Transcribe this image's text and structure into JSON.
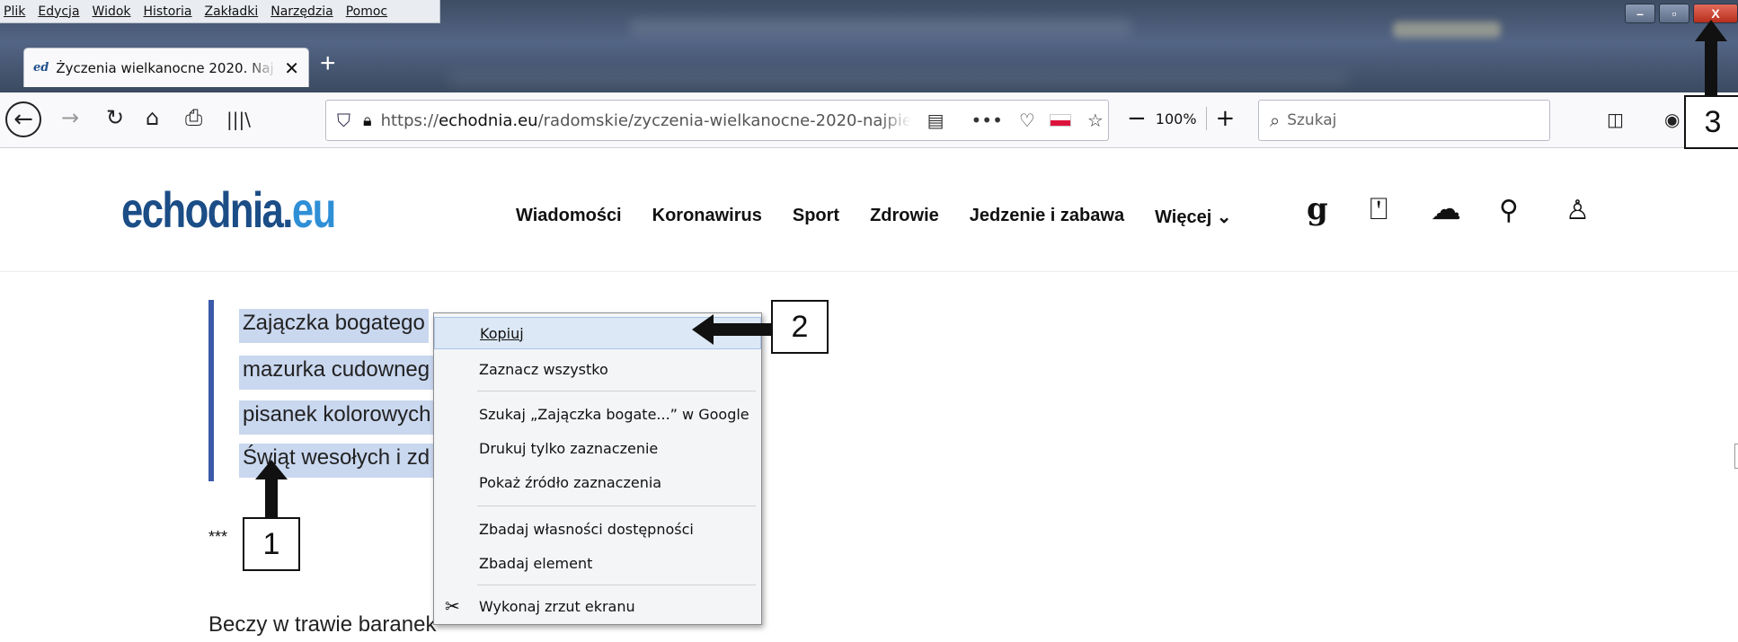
{
  "menubar": {
    "items": [
      {
        "label": "Plik"
      },
      {
        "label": "Edycja"
      },
      {
        "label": "Widok"
      },
      {
        "label": "Historia"
      },
      {
        "label": "Zakładki"
      },
      {
        "label": "Narzędzia"
      },
      {
        "label": "Pomoc"
      }
    ]
  },
  "window": {
    "minimize": "–",
    "restore": "▫",
    "close": "X"
  },
  "tab": {
    "favicon": "ed",
    "title": "Życzenia wielkanocne 2020. Naj",
    "close": "✕",
    "new_tab": "+"
  },
  "toolbar": {
    "url_prefix": "https://",
    "url_domain": "echodnia.eu",
    "url_path": "/radomskie/zyczenia-wielkanocne-2020-najpie",
    "zoom_out": "−",
    "zoom_level": "100%",
    "zoom_in": "+",
    "search_placeholder": "Szukaj"
  },
  "site": {
    "logo_main": "echodnia.",
    "logo_tld": "eu",
    "nav": [
      {
        "label": "Wiadomości"
      },
      {
        "label": "Koronawirus"
      },
      {
        "label": "Sport"
      },
      {
        "label": "Zdrowie"
      },
      {
        "label": "Jedzenie i zabawa"
      },
      {
        "label": "Więcej ⌄"
      }
    ]
  },
  "article": {
    "poem_lines": [
      "Zajączka bogatego",
      "mazurka cudowneg",
      "pisanek kolorowych",
      "Świąt wesołych i zd"
    ],
    "separator": "***",
    "next_line": "Beczy w trawie baranek"
  },
  "context_menu": {
    "items": [
      {
        "label": "Kopiuj"
      },
      {
        "label": "Zaznacz wszystko"
      },
      {
        "label": "Szukaj „Zajączka bogate...” w Google"
      },
      {
        "label": "Drukuj tylko zaznaczenie"
      },
      {
        "label": "Pokaż źródło zaznaczenia"
      },
      {
        "label": "Zbadaj własności dostępności"
      },
      {
        "label": "Zbadaj element"
      },
      {
        "label": "Wykonaj zrzut ekranu"
      }
    ]
  },
  "callouts": {
    "one": "1",
    "two": "2",
    "three": "3"
  },
  "colors": {
    "accent_blue": "#1b4d86",
    "selection": "#c9d7ef",
    "quote_bar": "#3a5aa8"
  }
}
